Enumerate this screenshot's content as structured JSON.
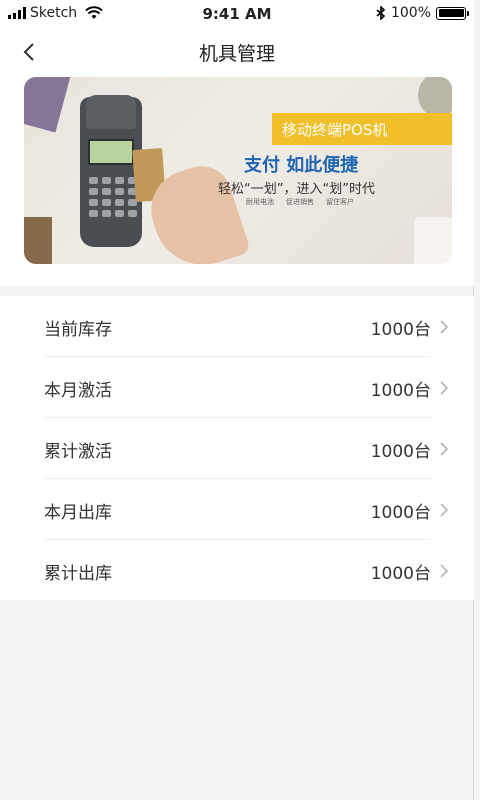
{
  "status_bar": {
    "carrier": "Sketch",
    "time": "9:41 AM",
    "battery": "100%"
  },
  "nav": {
    "title": "机具管理"
  },
  "banner": {
    "ribbon": "移动终端POS机",
    "headline": "支付 如此便捷",
    "subline": "轻松“一划”，进入“划”时代",
    "tags": [
      "耐用电池",
      "促进销售",
      "留住客户"
    ]
  },
  "stats": [
    {
      "label": "当前库存",
      "value": "1000台"
    },
    {
      "label": "本月激活",
      "value": "1000台"
    },
    {
      "label": "累计激活",
      "value": "1000台"
    },
    {
      "label": "本月出库",
      "value": "1000台"
    },
    {
      "label": "累计出库",
      "value": "1000台"
    }
  ],
  "icons": {
    "back": "chevron-left-icon",
    "row_arrow": "chevron-right-icon",
    "wifi": "wifi-icon",
    "bluetooth": "bluetooth-icon",
    "battery": "battery-icon",
    "signal": "signal-icon"
  }
}
